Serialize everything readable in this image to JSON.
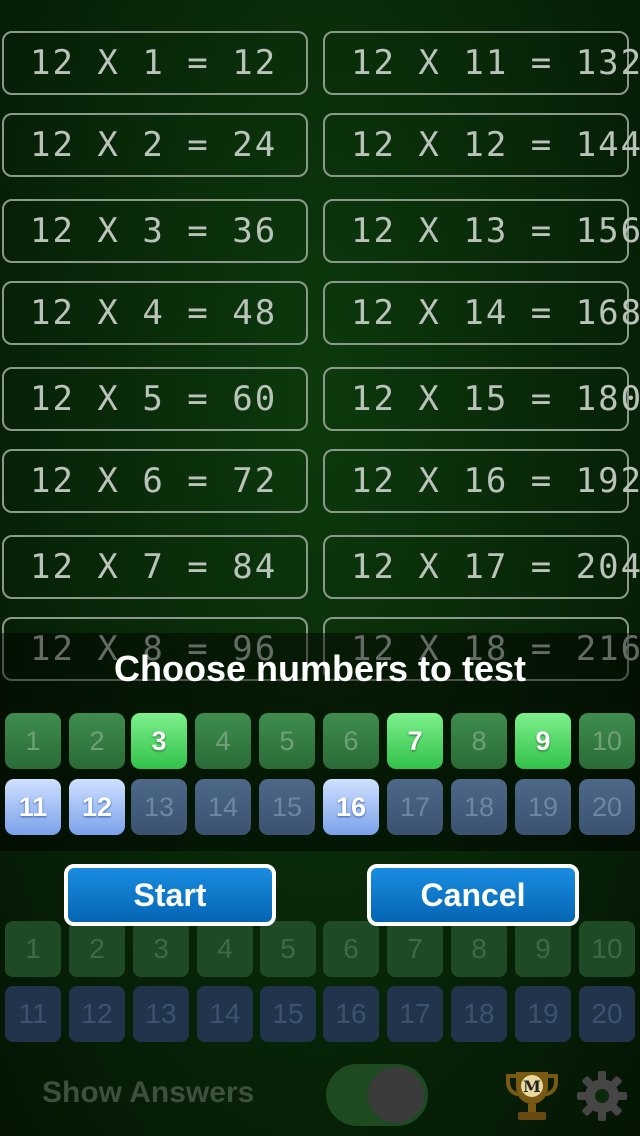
{
  "table": {
    "left": [
      "12 X 1 = 12",
      "12 X 2 = 24",
      "12 X 3 = 36",
      "12 X 4 = 48",
      "12 X 5 = 60",
      "12 X 6 = 72",
      "12 X 7 = 84",
      "12 X 8 = 96"
    ],
    "right": [
      "12 X 11 = 132",
      "12 X 12 = 144",
      "12 X 13 = 156",
      "12 X 14 = 168",
      "12 X 15 = 180",
      "12 X 16 = 192",
      "12 X 17 = 204",
      "12 X 18 = 216"
    ]
  },
  "dialog": {
    "title": "Choose numbers to test",
    "row1": [
      {
        "label": "1",
        "selected": false
      },
      {
        "label": "2",
        "selected": false
      },
      {
        "label": "3",
        "selected": true
      },
      {
        "label": "4",
        "selected": false
      },
      {
        "label": "5",
        "selected": false
      },
      {
        "label": "6",
        "selected": false
      },
      {
        "label": "7",
        "selected": true
      },
      {
        "label": "8",
        "selected": false
      },
      {
        "label": "9",
        "selected": true
      },
      {
        "label": "10",
        "selected": false
      }
    ],
    "row2": [
      {
        "label": "11",
        "selected": true
      },
      {
        "label": "12",
        "selected": true
      },
      {
        "label": "13",
        "selected": false
      },
      {
        "label": "14",
        "selected": false
      },
      {
        "label": "15",
        "selected": false
      },
      {
        "label": "16",
        "selected": true
      },
      {
        "label": "17",
        "selected": false
      },
      {
        "label": "18",
        "selected": false
      },
      {
        "label": "19",
        "selected": false
      },
      {
        "label": "20",
        "selected": false
      }
    ],
    "start_label": "Start",
    "cancel_label": "Cancel"
  },
  "background_controls": {
    "row1": [
      "1",
      "2",
      "3",
      "4",
      "5",
      "6",
      "7",
      "8",
      "9",
      "10"
    ],
    "row2": [
      "11",
      "12",
      "13",
      "14",
      "15",
      "16",
      "17",
      "18",
      "19",
      "20"
    ],
    "show_answers_label": "Show Answers",
    "show_answers_on": true,
    "trophy_icon": "trophy-icon",
    "trophy_letter": "M",
    "settings_icon": "gear-icon"
  },
  "colors": {
    "background": "#082608",
    "selected_green": "#32c24a",
    "selected_blue": "#7aa2ea",
    "button_blue": "#0a78cf"
  }
}
